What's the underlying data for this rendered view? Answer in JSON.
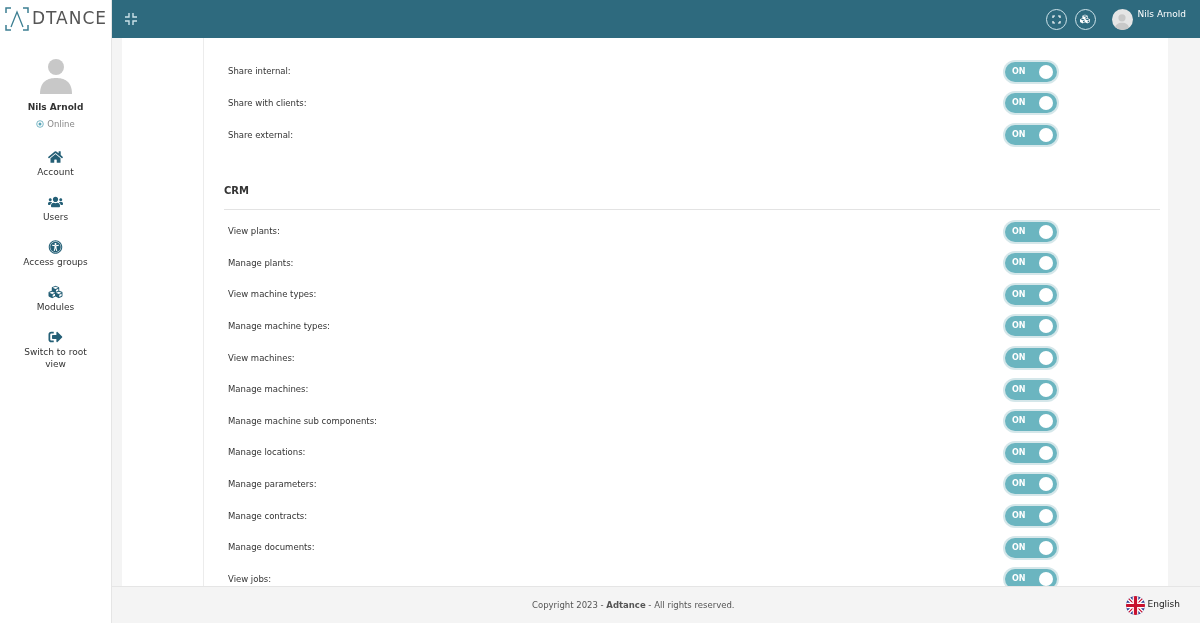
{
  "brand": "DTANCE",
  "user": {
    "name": "Nils Arnold",
    "status": "Online"
  },
  "nav": [
    {
      "kind": "home",
      "label": "Account"
    },
    {
      "kind": "users",
      "label": "Users"
    },
    {
      "kind": "access",
      "label": "Access groups"
    },
    {
      "kind": "modules",
      "label": "Modules"
    },
    {
      "kind": "switch",
      "label": "Switch to root view"
    }
  ],
  "header_user": "Nils Arnold",
  "sections": [
    {
      "permissions": [
        {
          "label": "Share internal:",
          "on": true,
          "text": "ON"
        },
        {
          "label": "Share with clients:",
          "on": true,
          "text": "ON"
        },
        {
          "label": "Share external:",
          "on": true,
          "text": "ON"
        }
      ]
    },
    {
      "title": "CRM",
      "permissions": [
        {
          "label": "View plants:",
          "on": true,
          "text": "ON"
        },
        {
          "label": "Manage plants:",
          "on": true,
          "text": "ON"
        },
        {
          "label": "View machine types:",
          "on": true,
          "text": "ON"
        },
        {
          "label": "Manage machine types:",
          "on": true,
          "text": "ON"
        },
        {
          "label": "View machines:",
          "on": true,
          "text": "ON"
        },
        {
          "label": "Manage machines:",
          "on": true,
          "text": "ON"
        },
        {
          "label": "Manage machine sub components:",
          "on": true,
          "text": "ON"
        },
        {
          "label": "Manage locations:",
          "on": true,
          "text": "ON"
        },
        {
          "label": "Manage parameters:",
          "on": true,
          "text": "ON"
        },
        {
          "label": "Manage contracts:",
          "on": true,
          "text": "ON"
        },
        {
          "label": "Manage documents:",
          "on": true,
          "text": "ON"
        },
        {
          "label": "View jobs:",
          "on": true,
          "text": "ON"
        }
      ]
    }
  ],
  "footer": {
    "text": "Copyright 2023 - **Adtance** - All rights reserved.",
    "language": "English"
  }
}
